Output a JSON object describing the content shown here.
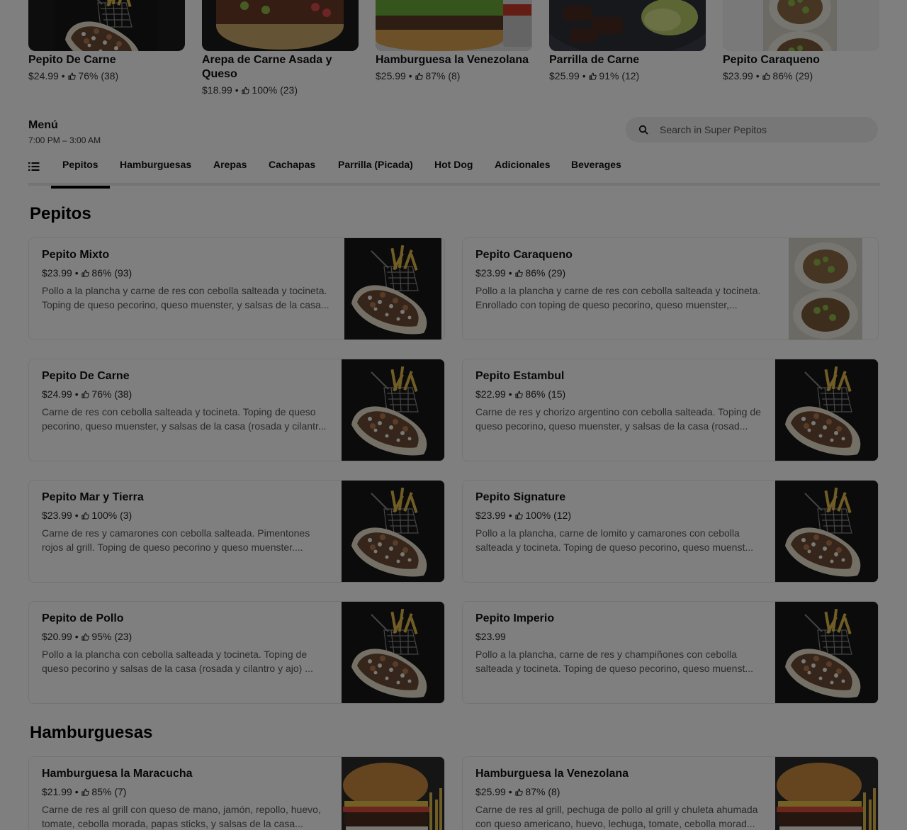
{
  "featured": [
    {
      "name": "Pepito De Carne",
      "price": "$24.99",
      "rating": "76% (38)"
    },
    {
      "name": "Arepa de Carne Asada y Queso",
      "price": "$18.99",
      "rating": "100% (23)"
    },
    {
      "name": "Hamburguesa la Venezolana",
      "price": "$25.99",
      "rating": "87% (8)"
    },
    {
      "name": "Parrilla de Carne",
      "price": "$25.99",
      "rating": "91% (12)"
    },
    {
      "name": "Pepito Caraqueno",
      "price": "$23.99",
      "rating": "86% (29)"
    }
  ],
  "menu": {
    "title": "Menú",
    "hours": "7:00 PM – 3:00 AM"
  },
  "search": {
    "placeholder": "Search in Super Pepitos",
    "value": ""
  },
  "tabs": [
    "Pepitos",
    "Hamburguesas",
    "Arepas",
    "Cachapas",
    "Parrilla (Picada)",
    "Hot Dog",
    "Adicionales",
    "Beverages"
  ],
  "active_tab": "Pepitos",
  "sections": [
    {
      "title": "Pepitos",
      "items": [
        {
          "name": "Pepito Mixto",
          "price": "$23.99",
          "rating": "86% (93)",
          "desc": "Pollo a la plancha y carne de res con cebolla salteada y tocineta. Toping de queso pecorino, queso muenster, y salsas de la casa..."
        },
        {
          "name": "Pepito Caraqueno",
          "price": "$23.99",
          "rating": "86% (29)",
          "desc": "Pollo a la plancha y carne de res con cebolla salteada y tocineta. Enrollado con toping de queso pecorino, queso muenster,..."
        },
        {
          "name": "Pepito De Carne",
          "price": "$24.99",
          "rating": "76% (38)",
          "desc": "Carne de res con cebolla salteada y tocineta. Toping de queso pecorino, queso muenster, y salsas de la casa (rosada y cilantr..."
        },
        {
          "name": "Pepito Estambul",
          "price": "$22.99",
          "rating": "86% (15)",
          "desc": "Carne de res y chorizo argentino con cebolla salteada. Toping de queso pecorino, queso muenster, y salsas de la casa (rosad..."
        },
        {
          "name": "Pepito Mar y Tierra",
          "price": "$23.99",
          "rating": "100% (3)",
          "desc": "Carne de res y camarones con cebolla salteada. Pimentones rojos al grill. Toping de queso pecorino y queso muenster...."
        },
        {
          "name": "Pepito Signature",
          "price": "$23.99",
          "rating": "100% (12)",
          "desc": "Pollo a la plancha, carne de lomito y camarones con cebolla salteada y tocineta. Toping de queso pecorino, queso muenst..."
        },
        {
          "name": "Pepito de Pollo",
          "price": "$20.99",
          "rating": "95% (23)",
          "desc": "Pollo a la plancha con cebolla salteada y tocineta. Toping de queso pecorino y salsas de la casa (rosada y cilantro y ajo) ..."
        },
        {
          "name": "Pepito Imperio",
          "price": "$23.99",
          "rating": "",
          "desc": "Pollo a la plancha, carne de res y champiñones con cebolla salteada y tocineta. Toping de queso pecorino, queso muenst..."
        }
      ]
    },
    {
      "title": "Hamburguesas",
      "items": [
        {
          "name": "Hamburguesa la Maracucha",
          "price": "$21.99",
          "rating": "85% (7)",
          "desc": "Carne de res al grill con queso de mano, jamón, repollo, huevo, tomate, cebolla morada, papas sticks, y salsas de la casa..."
        },
        {
          "name": "Hamburguesa la Venezolana",
          "price": "$25.99",
          "rating": "87% (8)",
          "desc": "Carne de res al grill, pechuga de pollo al grill y chuleta ahumada con queso americano, huevo, lechuga, tomate, cebolla morad..."
        }
      ]
    }
  ],
  "icons": {
    "rating": "thumbs-up-icon",
    "search": "search-icon",
    "menu_list": "list-icon"
  },
  "colors": {
    "accent": "#000000",
    "text_secondary": "#545454",
    "search_bg": "#eeeeee"
  }
}
